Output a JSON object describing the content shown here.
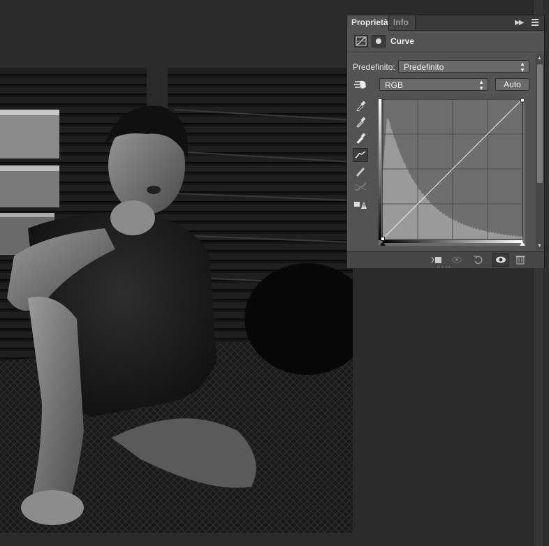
{
  "panel": {
    "tabs": [
      {
        "label": "Proprietà",
        "active": true
      },
      {
        "label": "Info",
        "active": false
      }
    ],
    "title": "Curve",
    "preset_label": "Predefinito:",
    "preset_value": "Predefinito",
    "channel_value": "RGB",
    "auto_label": "Auto"
  },
  "icons": {
    "tabbar": [
      "collapse-icon",
      "panel-menu-icon"
    ],
    "header": [
      "adjustment-layer-icon",
      "layer-mask-icon"
    ],
    "tools": [
      "on-image-adjust-icon",
      "black-point-eyedropper-icon",
      "gray-point-eyedropper-icon",
      "white-point-eyedropper-icon",
      "curve-points-icon",
      "pencil-draw-icon",
      "smooth-curve-icon",
      "clipping-warning-icon"
    ],
    "bottom": [
      "clip-to-layer-icon",
      "view-previous-state-icon",
      "reset-icon",
      "visibility-eye-icon",
      "delete-trash-icon"
    ]
  },
  "colors": {
    "panel_bg": "#535353",
    "workspace_bg": "#2b2b2b",
    "curve_bg": "#6e6e6e",
    "histogram": "#9a9a9a",
    "curve_line": "#f2f2f2"
  },
  "curve": {
    "points": [
      [
        0,
        0
      ],
      [
        255,
        255
      ]
    ],
    "channel": "RGB"
  }
}
